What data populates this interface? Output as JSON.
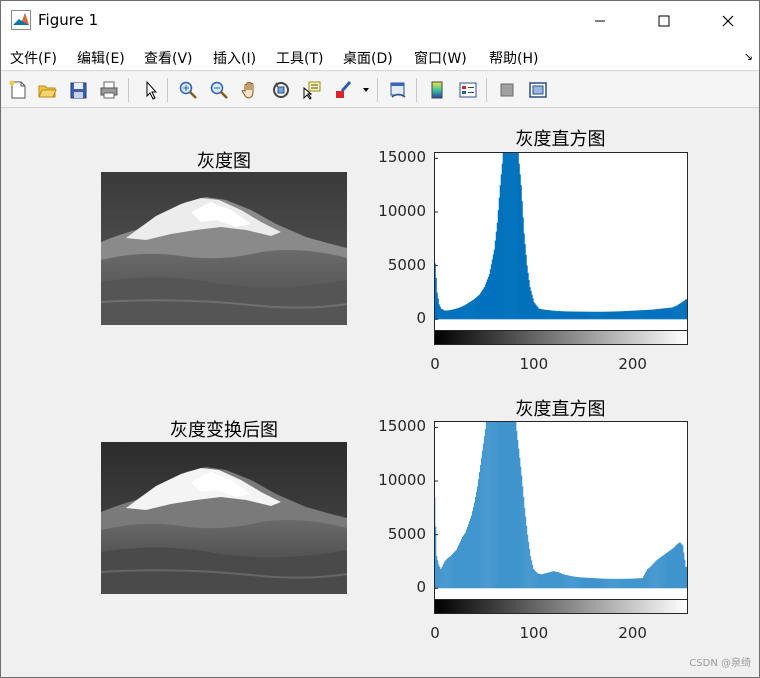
{
  "window": {
    "title": "Figure 1"
  },
  "menu": [
    {
      "label": "文件(F)"
    },
    {
      "label": "编辑(E)"
    },
    {
      "label": "查看(V)"
    },
    {
      "label": "插入(I)"
    },
    {
      "label": "工具(T)"
    },
    {
      "label": "桌面(D)"
    },
    {
      "label": "窗口(W)"
    },
    {
      "label": "帮助(H)"
    }
  ],
  "toolbar": {
    "icons": [
      "new-figure-icon",
      "open-folder-icon",
      "save-icon",
      "print-icon",
      "pointer-icon",
      "zoom-in-icon",
      "zoom-out-icon",
      "pan-hand-icon",
      "rotate-3d-icon",
      "data-cursor-icon",
      "brush-icon",
      "brush-dropdown-icon",
      "link-plot-icon",
      "colorbar-icon",
      "legend-icon",
      "hide-plot-tools-icon",
      "show-plot-tools-icon"
    ]
  },
  "figure": {
    "images": [
      {
        "title": "灰度图"
      },
      {
        "title": "灰度变换后图"
      }
    ],
    "histograms": [
      {
        "title": "灰度直方图"
      },
      {
        "title": "灰度直方图"
      }
    ]
  },
  "chart_data": [
    {
      "type": "bar",
      "title": "灰度直方图",
      "xlabel": "",
      "ylabel": "",
      "xlim": [
        0,
        255
      ],
      "ylim": [
        -1000,
        15500
      ],
      "xticks": [
        0,
        100,
        200
      ],
      "xtick_labels": [
        "0",
        "100",
        "200"
      ],
      "yticks": [
        0,
        5000,
        10000,
        15000
      ],
      "ytick_labels": [
        "0",
        "5000",
        "10000",
        "15000"
      ],
      "color": "#0072bd",
      "bins_x": [
        0,
        2,
        4,
        6,
        8,
        10,
        15,
        20,
        25,
        30,
        35,
        40,
        45,
        50,
        55,
        60,
        63,
        66,
        69,
        72,
        75,
        78,
        81,
        84,
        87,
        90,
        93,
        96,
        100,
        105,
        110,
        115,
        120,
        125,
        130,
        140,
        150,
        160,
        170,
        180,
        190,
        200,
        210,
        220,
        230,
        240,
        245,
        250,
        253,
        255
      ],
      "counts": [
        5200,
        2500,
        1400,
        1000,
        900,
        800,
        850,
        950,
        1100,
        1300,
        1600,
        1900,
        2300,
        3000,
        4200,
        6500,
        9000,
        12500,
        15500,
        15500,
        15500,
        15500,
        15500,
        15500,
        12500,
        8000,
        5000,
        3000,
        1600,
        1000,
        900,
        850,
        800,
        760,
        740,
        720,
        710,
        700,
        700,
        720,
        750,
        800,
        850,
        900,
        1000,
        1100,
        1300,
        1600,
        1800,
        1900
      ]
    },
    {
      "type": "bar",
      "title": "灰度直方图",
      "xlabel": "",
      "ylabel": "",
      "xlim": [
        0,
        255
      ],
      "ylim": [
        -1000,
        15500
      ],
      "xticks": [
        0,
        100,
        200
      ],
      "xtick_labels": [
        "0",
        "100",
        "200"
      ],
      "yticks": [
        0,
        5000,
        10000,
        15000
      ],
      "ytick_labels": [
        "0",
        "5000",
        "10000",
        "15000"
      ],
      "color": "#0072bd",
      "bins_x": [
        0,
        2,
        4,
        6,
        8,
        10,
        13,
        16,
        19,
        22,
        25,
        28,
        31,
        34,
        37,
        40,
        43,
        46,
        49,
        52,
        55,
        58,
        61,
        64,
        67,
        70,
        73,
        76,
        79,
        82,
        85,
        88,
        91,
        94,
        97,
        100,
        104,
        108,
        112,
        116,
        120,
        125,
        130,
        135,
        140,
        150,
        160,
        170,
        180,
        190,
        200,
        210,
        215,
        218,
        221,
        224,
        227,
        230,
        233,
        236,
        239,
        242,
        245,
        248,
        251,
        254
      ],
      "counts": [
        8500,
        3000,
        2200,
        1800,
        2100,
        2500,
        2800,
        3000,
        3300,
        3600,
        4200,
        4800,
        5200,
        6000,
        6800,
        8000,
        9500,
        11500,
        13500,
        15500,
        15500,
        15500,
        15500,
        15500,
        15500,
        15500,
        15500,
        15500,
        15500,
        15500,
        13000,
        10500,
        7500,
        5000,
        3000,
        1800,
        1400,
        1300,
        1400,
        1500,
        1600,
        1500,
        1300,
        1200,
        1100,
        1000,
        950,
        900,
        880,
        880,
        900,
        950,
        1800,
        2000,
        2300,
        2600,
        2800,
        3000,
        3200,
        3400,
        3600,
        3800,
        4100,
        4300,
        4000,
        2000
      ]
    }
  ],
  "watermark": "CSDN @泉绮"
}
